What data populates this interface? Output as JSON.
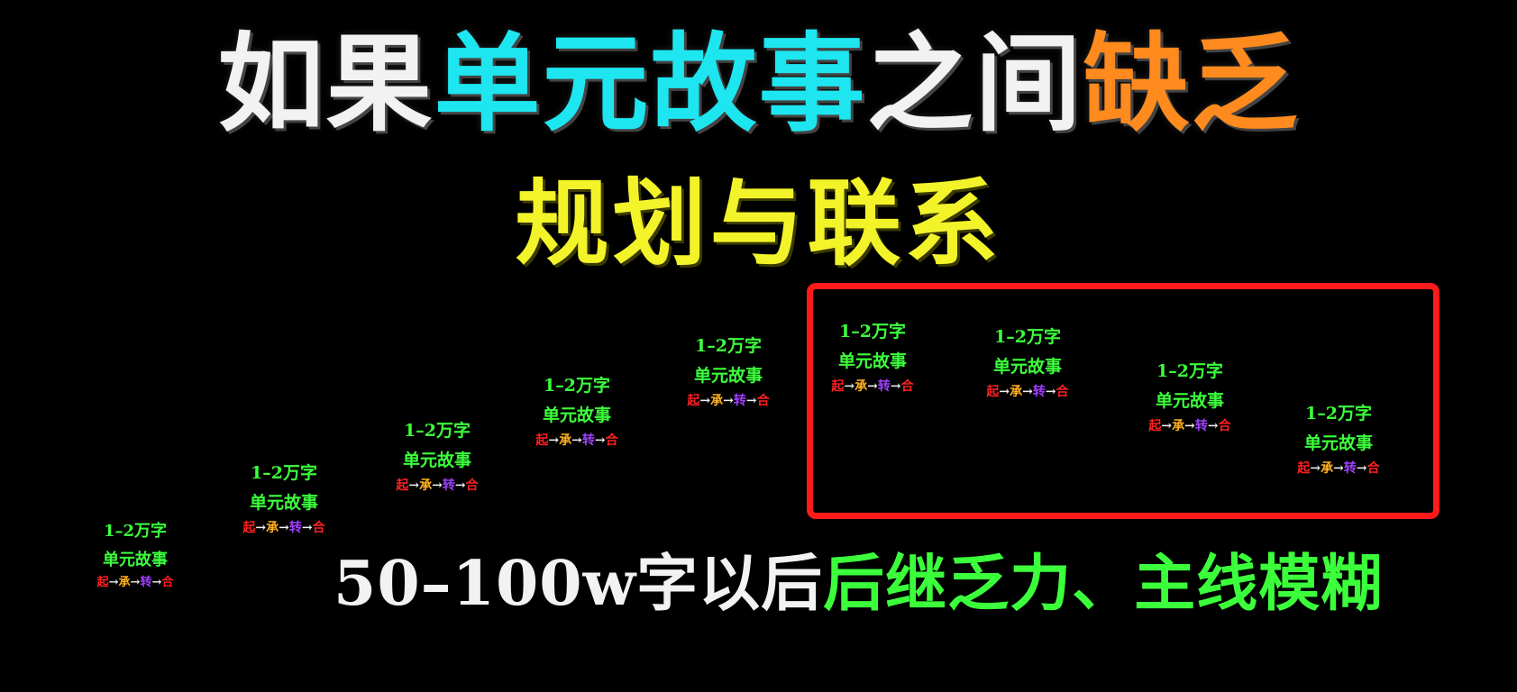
{
  "colors": {
    "white": "#f2f2f2",
    "cyan": "#1ee6f0",
    "orange": "#ff8a1e",
    "yellow": "#f3f32a",
    "green": "#3cff3c",
    "red": "#ff2020",
    "amber": "#ffb020",
    "purple": "#a040ff",
    "frame": "#ff1a1a"
  },
  "title": {
    "line1": [
      {
        "text": "如果",
        "color": "white"
      },
      {
        "text": "单元故事",
        "color": "cyan"
      },
      {
        "text": "之间",
        "color": "white"
      },
      {
        "text": "缺乏",
        "color": "orange"
      }
    ],
    "line2": "规划与联系"
  },
  "units": [
    {
      "word_count": "1–2万字",
      "label": "单元故事",
      "flow": [
        "起",
        "承",
        "转",
        "合"
      ]
    },
    {
      "word_count": "1–2万字",
      "label": "单元故事",
      "flow": [
        "起",
        "承",
        "转",
        "合"
      ]
    },
    {
      "word_count": "1–2万字",
      "label": "单元故事",
      "flow": [
        "起",
        "承",
        "转",
        "合"
      ]
    },
    {
      "word_count": "1–2万字",
      "label": "单元故事",
      "flow": [
        "起",
        "承",
        "转",
        "合"
      ]
    },
    {
      "word_count": "1–2万字",
      "label": "单元故事",
      "flow": [
        "起",
        "承",
        "转",
        "合"
      ]
    },
    {
      "word_count": "1–2万字",
      "label": "单元故事",
      "flow": [
        "起",
        "承",
        "转",
        "合"
      ]
    },
    {
      "word_count": "1–2万字",
      "label": "单元故事",
      "flow": [
        "起",
        "承",
        "转",
        "合"
      ]
    },
    {
      "word_count": "1–2万字",
      "label": "单元故事",
      "flow": [
        "起",
        "承",
        "转",
        "合"
      ]
    },
    {
      "word_count": "1–2万字",
      "label": "单元故事",
      "flow": [
        "起",
        "承",
        "转",
        "合"
      ]
    }
  ],
  "flow_arrow": "→",
  "bottom_caption": {
    "lead": "50–100w字以后",
    "highlight": "后继乏力、主线模糊"
  }
}
